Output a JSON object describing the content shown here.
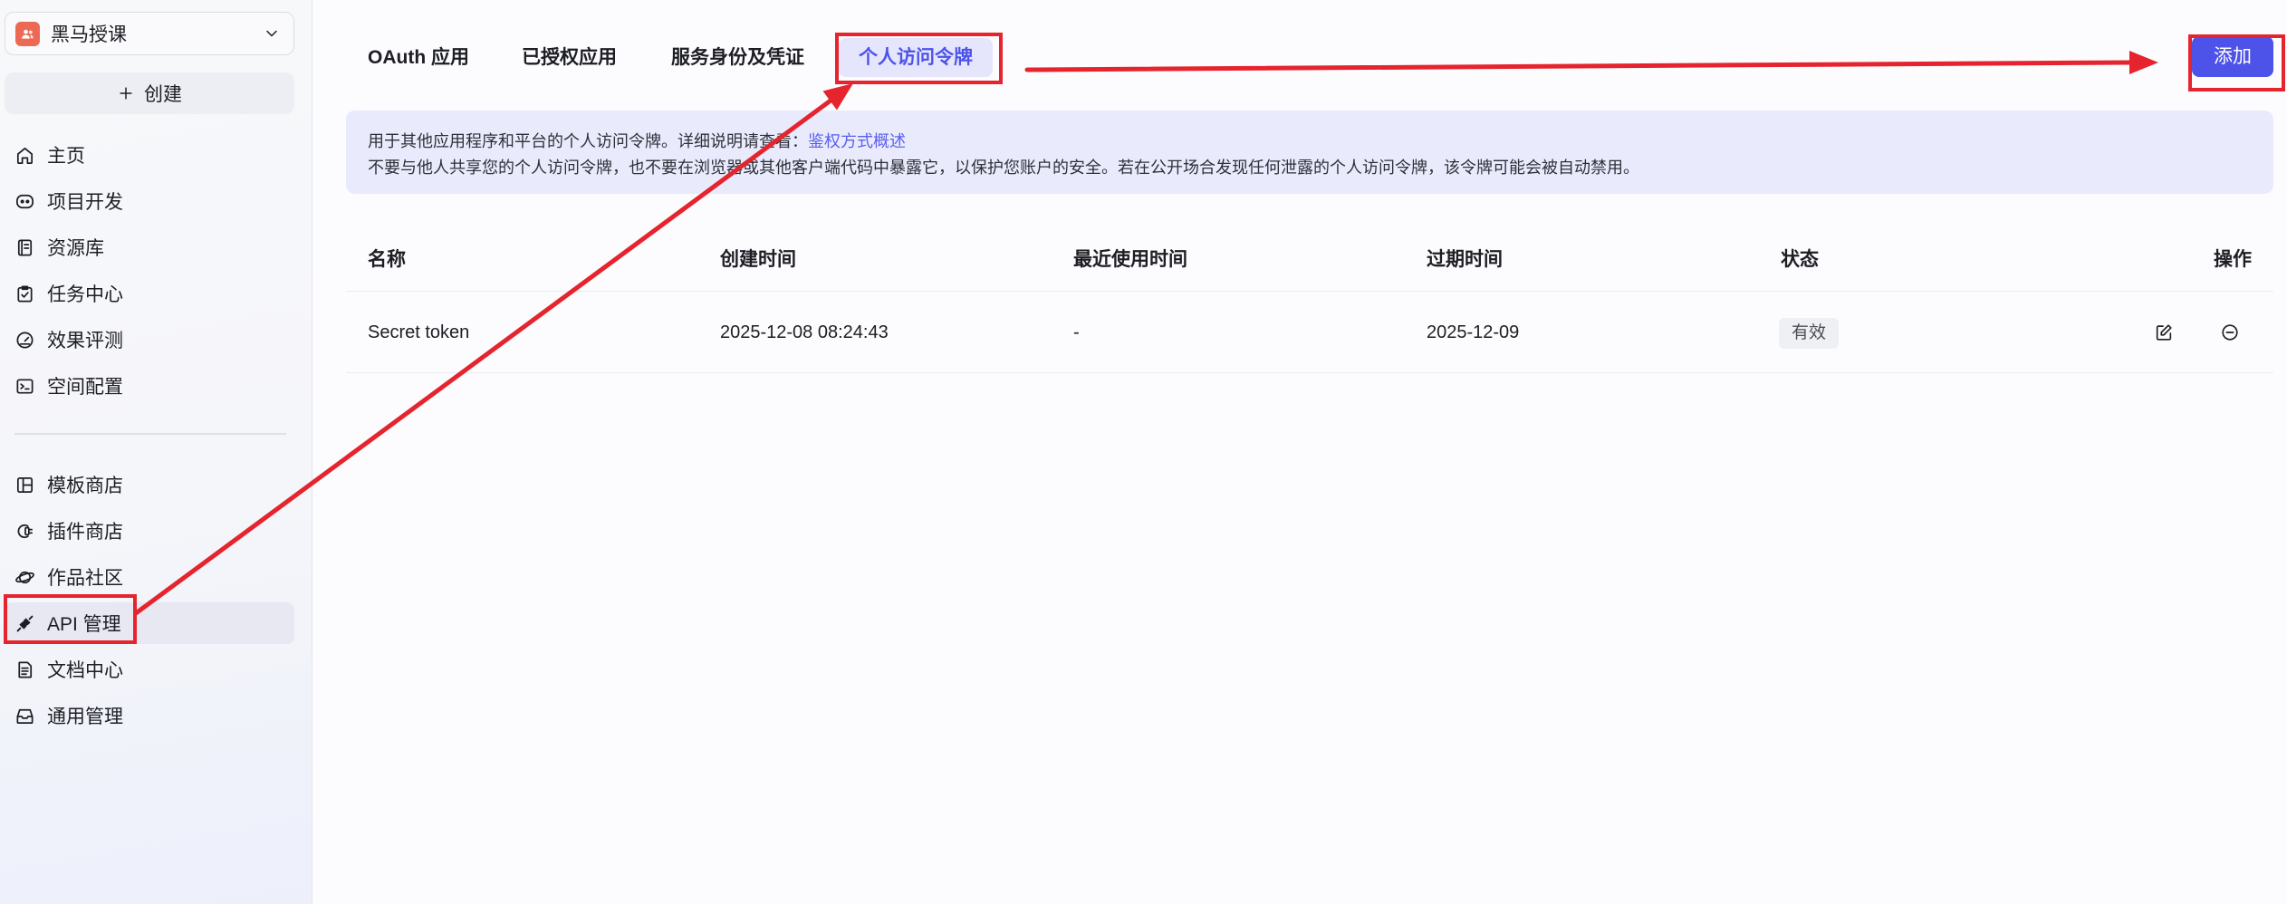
{
  "sidebar": {
    "workspace": {
      "name": "黑马授课",
      "icon": "team-icon",
      "chevron": "chevron-down-icon"
    },
    "create": {
      "label": "创建",
      "icon": "plus-icon"
    },
    "menu_primary": [
      {
        "label": "主页",
        "icon": "home-icon"
      },
      {
        "label": "项目开发",
        "icon": "bot-icon"
      },
      {
        "label": "资源库",
        "icon": "library-icon"
      },
      {
        "label": "任务中心",
        "icon": "task-icon"
      },
      {
        "label": "效果评测",
        "icon": "gauge-icon"
      },
      {
        "label": "空间配置",
        "icon": "terminal-icon"
      }
    ],
    "menu_secondary": [
      {
        "label": "模板商店",
        "icon": "template-icon"
      },
      {
        "label": "插件商店",
        "icon": "plugin-icon"
      },
      {
        "label": "作品社区",
        "icon": "planet-icon"
      },
      {
        "label": "API 管理",
        "icon": "api-icon",
        "active": true
      },
      {
        "label": "文档中心",
        "icon": "document-icon"
      },
      {
        "label": "通用管理",
        "icon": "tray-icon"
      }
    ]
  },
  "tabs": [
    {
      "label": "OAuth 应用"
    },
    {
      "label": "已授权应用"
    },
    {
      "label": "服务身份及凭证"
    },
    {
      "label": "个人访问令牌",
      "active": true
    }
  ],
  "toolbar": {
    "add_label": "添加"
  },
  "notice": {
    "intro": "用于其他应用程序和平台的个人访问令牌。详细说明请查看：",
    "link": "鉴权方式概述",
    "warning": "不要与他人共享您的个人访问令牌，也不要在浏览器或其他客户端代码中暴露它，以保护您账户的安全。若在公开场合发现任何泄露的个人访问令牌，该令牌可能会被自动禁用。"
  },
  "table": {
    "columns": [
      "名称",
      "创建时间",
      "最近使用时间",
      "过期时间",
      "状态",
      "操作"
    ],
    "rows": [
      {
        "name": "Secret token",
        "created": "2025-12-08 08:24:43",
        "last_used": "-",
        "expires": "2025-12-09",
        "status": "有效",
        "actions": [
          "edit-icon",
          "remove-icon"
        ]
      }
    ]
  },
  "colors": {
    "accent": "#4d53e8",
    "active_tab_bg": "#e5e6fc",
    "active_menu_bg": "#e7e8f1",
    "notice_bg": "#e9ebfd",
    "link": "#5a5fec",
    "status_badge_bg": "#eff0f4",
    "workspace_icon": "#ec6a54",
    "annotation": "#e5242e"
  }
}
